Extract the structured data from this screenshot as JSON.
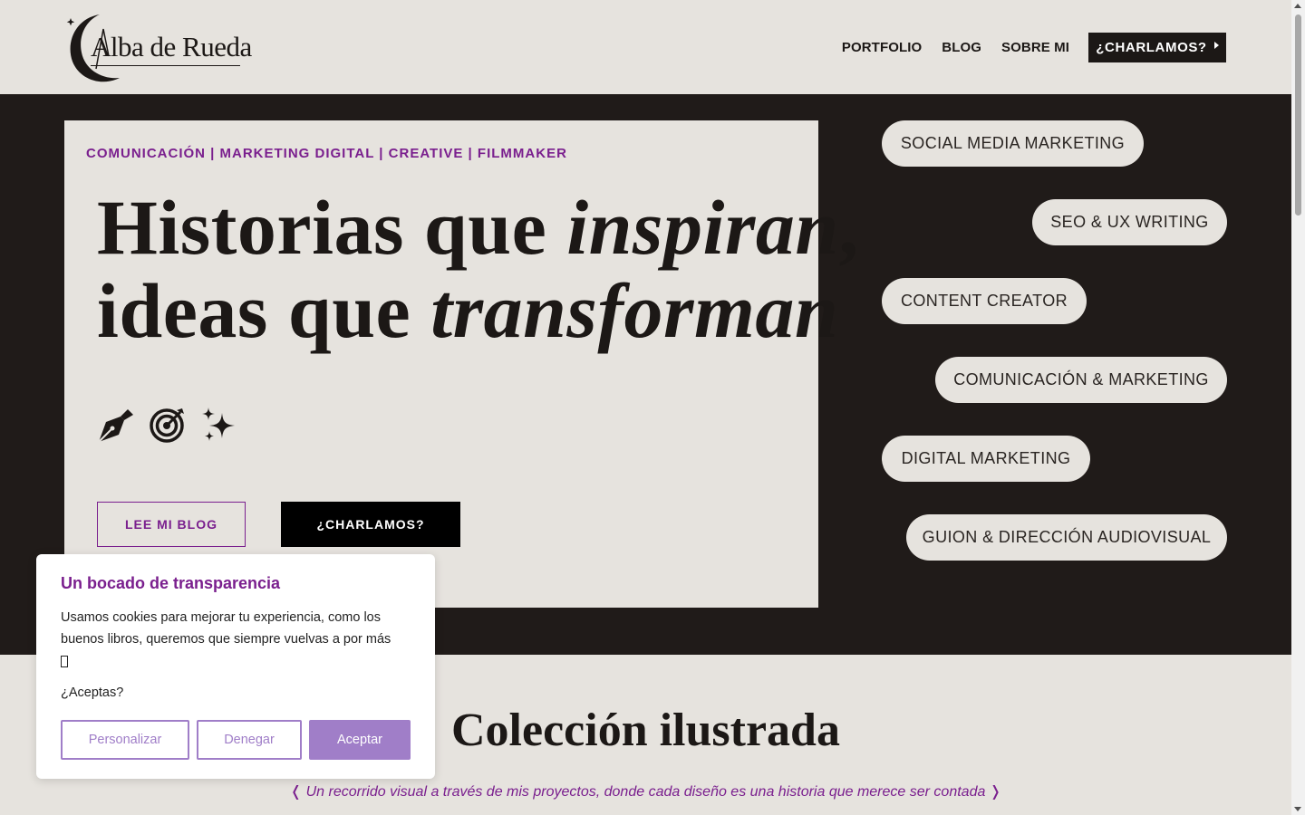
{
  "header": {
    "logo_text": "Alba de Rueda",
    "nav": [
      {
        "label": "PORTFOLIO"
      },
      {
        "label": "BLOG"
      },
      {
        "label": "SOBRE MI"
      }
    ],
    "cta_label": "¿CHARLAMOS?"
  },
  "hero": {
    "tagline": "COMUNICACIÓN | MARKETING DIGITAL | CREATIVE | FILMMAKER",
    "headline_line1_a": "Historias que ",
    "headline_line1_b": "inspiran",
    "headline_line1_c": ",",
    "headline_line2_a": "ideas que ",
    "headline_line2_b": "transforman",
    "icons": [
      "pen-nib-icon",
      "target-icon",
      "sparkles-icon"
    ],
    "blog_button": "LEE MI BLOG",
    "chat_button": "¿CHARLAMOS?",
    "pills": [
      "SOCIAL MEDIA MARKETING",
      "SEO & UX WRITING",
      "CONTENT CREATOR",
      "COMUNICACIÓN & MARKETING",
      "DIGITAL MARKETING",
      "GUION & DIRECCIÓN AUDIOVISUAL"
    ]
  },
  "collection": {
    "title": "Colección ilustrada",
    "subtitle": "❬ Un recorrido visual a través de mis proyectos, donde cada diseño es una historia que merece ser contada ❭"
  },
  "cookie": {
    "title": "Un bocado de transparencia",
    "text": "Usamos cookies para mejorar tu experiencia, como los buenos libros, queremos que siempre vuelvas a por más",
    "question": "¿Aceptas?",
    "customize": "Personalizar",
    "deny": "Denegar",
    "accept": "Aceptar"
  },
  "colors": {
    "accent_purple": "#7a1f8e",
    "cookie_button": "#a07ec8",
    "dark_bg": "#201b19",
    "light_bg": "#e6e3de"
  }
}
